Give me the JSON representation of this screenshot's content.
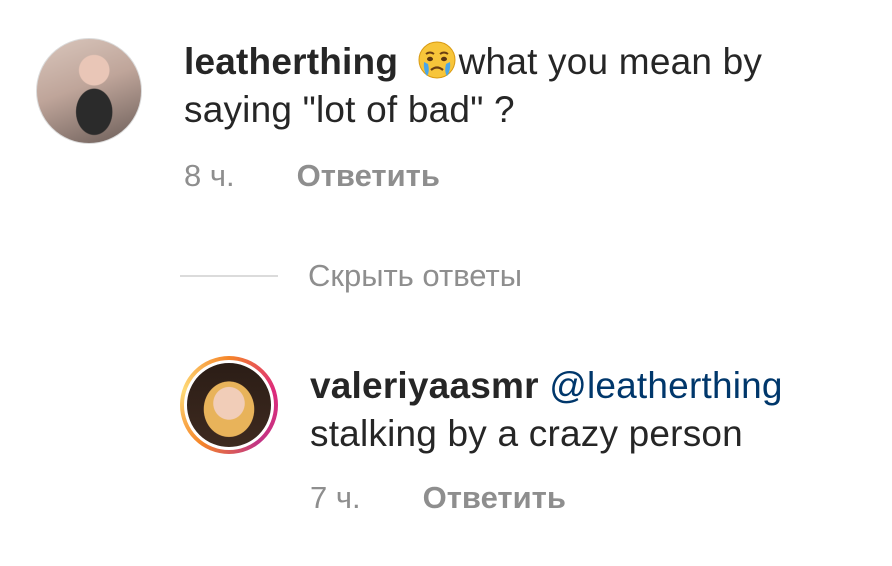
{
  "comments": [
    {
      "username": "leatherthing",
      "emoji": "crying-face-emoji",
      "text": "what you mean by saying \"lot of bad\" ?",
      "time": "8 ч.",
      "reply_label": "Ответить"
    },
    {
      "username": "valeriyaasmr",
      "mention": "@leatherthing",
      "text": "stalking by a crazy person",
      "time": "7 ч.",
      "reply_label": "Ответить"
    }
  ],
  "hide_replies_label": "Скрыть ответы",
  "colors": {
    "text": "#262626",
    "secondary": "#8e8e8e",
    "mention": "#00376b",
    "divider": "#dbdbdb"
  }
}
